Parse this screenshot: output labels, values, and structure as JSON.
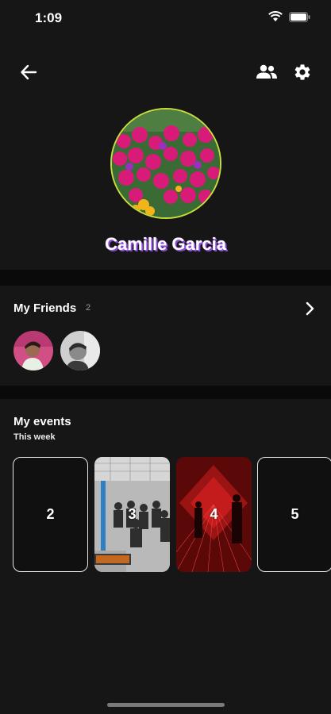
{
  "status": {
    "time": "1:09"
  },
  "profile": {
    "name": "Camille Garcia"
  },
  "friends": {
    "title": "My Friends",
    "count": "2"
  },
  "events": {
    "title": "My events",
    "subtitle": "This week",
    "cards": [
      {
        "label": "2"
      },
      {
        "label": "3"
      },
      {
        "label": "4"
      },
      {
        "label": "5"
      }
    ]
  },
  "colors": {
    "avatar_ring": "#c8dc3c",
    "name_glow": "#b06cff",
    "background": "#0a0a0a",
    "panel": "#161616"
  },
  "icons": [
    "signal-icon",
    "wifi-icon",
    "battery-icon",
    "back-arrow-icon",
    "people-icon",
    "gear-icon",
    "chevron-right-icon"
  ]
}
